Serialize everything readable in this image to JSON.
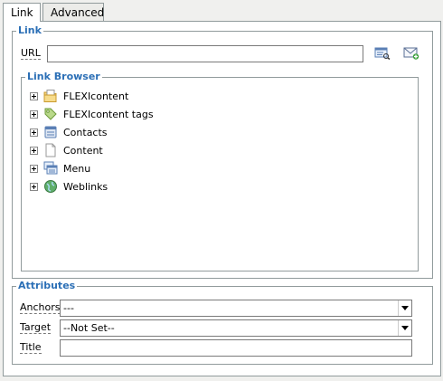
{
  "tabs": [
    {
      "label": "Link",
      "active": true
    },
    {
      "label": "Advanced",
      "active": false
    }
  ],
  "link_section": {
    "legend": "Link",
    "url_label": "URL",
    "url_value": "",
    "browse_icon": "browse-icon",
    "email_icon": "email-icon"
  },
  "link_browser": {
    "legend": "Link Browser",
    "items": [
      {
        "label": "FLEXIcontent",
        "icon": "folder-icon"
      },
      {
        "label": "FLEXIcontent tags",
        "icon": "tag-icon"
      },
      {
        "label": "Contacts",
        "icon": "contacts-icon"
      },
      {
        "label": "Content",
        "icon": "document-icon"
      },
      {
        "label": "Menu",
        "icon": "menu-icon"
      },
      {
        "label": "Weblinks",
        "icon": "globe-icon"
      }
    ]
  },
  "attributes": {
    "legend": "Attributes",
    "anchors_label": "Anchors",
    "anchors_value": "---",
    "target_label": "Target",
    "target_value": "--Not Set--",
    "title_label": "Title",
    "title_value": ""
  }
}
